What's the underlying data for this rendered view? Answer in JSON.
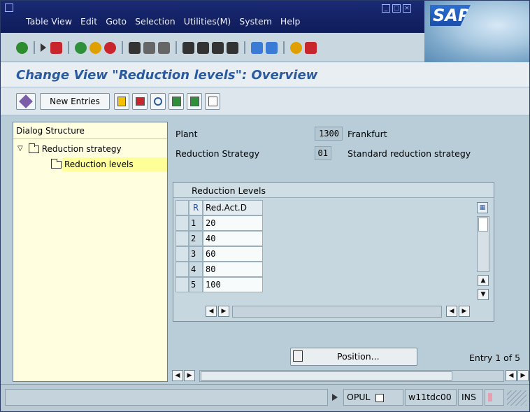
{
  "window": {
    "menu": [
      "Table View",
      "Edit",
      "Goto",
      "Selection",
      "Utilities(M)",
      "System",
      "Help"
    ],
    "brand": "SAP"
  },
  "standard_toolbar": {
    "icons": [
      "enter-icon",
      "command-field-icon",
      "save-icon",
      "back-icon",
      "exit-icon",
      "cancel-icon",
      "print-icon",
      "find-icon",
      "find-next-icon",
      "first-page-icon",
      "previous-page-icon",
      "next-page-icon",
      "last-page-icon",
      "create-session-icon",
      "shortcut-icon",
      "help-icon",
      "layout-menu-icon"
    ]
  },
  "page": {
    "title": "Change View \"Reduction levels\": Overview"
  },
  "app_toolbar": {
    "new_entries_label": "New Entries",
    "icons": [
      "display-change-icon",
      "copy-as-icon",
      "delete-icon",
      "undo-icon",
      "select-all-icon",
      "select-block-icon",
      "deselect-all-icon"
    ]
  },
  "dialog_structure": {
    "title": "Dialog Structure",
    "items": [
      {
        "label": "Reduction strategy",
        "level": 0,
        "expanded": true
      },
      {
        "label": "Reduction levels",
        "level": 1,
        "selected": true
      }
    ]
  },
  "header_fields": {
    "plant_label": "Plant",
    "plant_value": "1300",
    "plant_desc": "Frankfurt",
    "strategy_label": "Reduction Strategy",
    "strategy_value": "01",
    "strategy_desc": "Standard reduction strategy"
  },
  "table": {
    "title": "Reduction Levels",
    "columns": [
      "R",
      "Red.Act.D"
    ],
    "rows": [
      {
        "r": "1",
        "value": "20"
      },
      {
        "r": "2",
        "value": "40"
      },
      {
        "r": "3",
        "value": "60"
      },
      {
        "r": "4",
        "value": "80"
      },
      {
        "r": "5",
        "value": "100"
      }
    ]
  },
  "position_button": {
    "label": "Position..."
  },
  "entry_info": "Entry 1 of 5",
  "status_bar": {
    "system": "OPUL",
    "server": "w11tdc00",
    "mode": "INS"
  },
  "colors": {
    "menubar": "#0f1c5a",
    "title_text": "#2a5aa0",
    "tree_bg": "#ffffe0",
    "tree_selected": "#ffff99",
    "screen_bg": "#b9cdd8"
  }
}
